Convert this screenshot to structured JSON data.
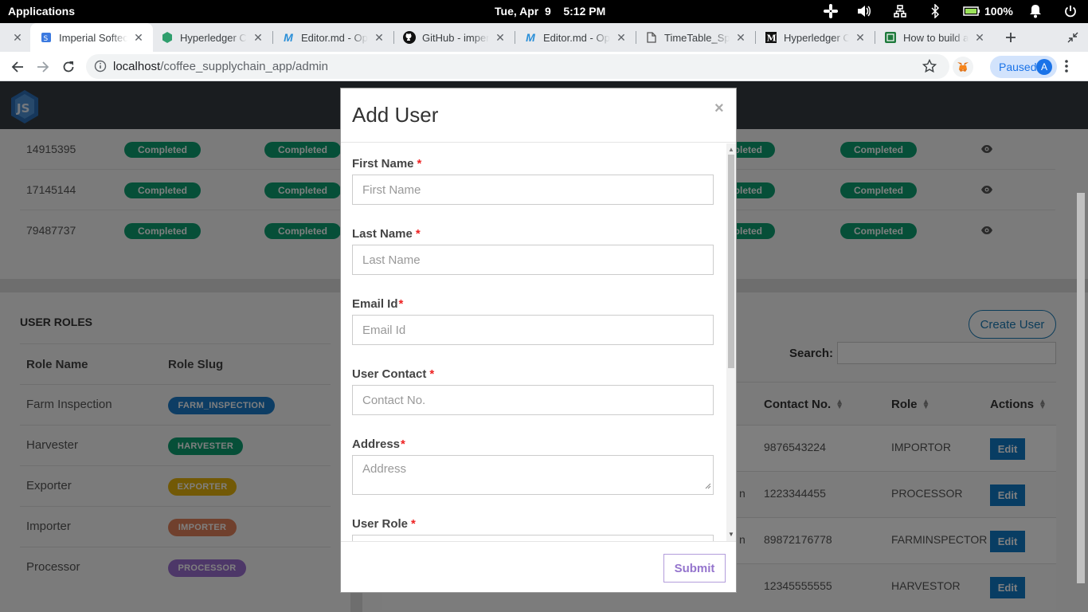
{
  "os": {
    "applications": "Applications",
    "clock": "Tue, Apr  9    5:12 PM",
    "battery": "100%"
  },
  "tabs": [
    {
      "title": "Imperial Softech"
    },
    {
      "title": "Hyperledger Co"
    },
    {
      "title": "Editor.md - Ope"
    },
    {
      "title": "GitHub - imperi"
    },
    {
      "title": "Editor.md - Ope"
    },
    {
      "title": "TimeTable_Spl"
    },
    {
      "title": "Hyperledger Co"
    },
    {
      "title": "How to build a l"
    }
  ],
  "address": {
    "host": "localhost",
    "path": "/coffee_supplychain_app/admin",
    "profile_status": "Paused",
    "avatar_letter": "A"
  },
  "orders": {
    "rows": [
      {
        "id": "14915395",
        "statuses": [
          "Completed",
          "Completed",
          "Completed",
          "Completed"
        ]
      },
      {
        "id": "17145144",
        "statuses": [
          "Completed",
          "Completed",
          "Completed",
          "Completed"
        ]
      },
      {
        "id": "79487737",
        "statuses": [
          "Completed",
          "Completed",
          "Completed",
          "Completed"
        ]
      }
    ]
  },
  "roles": {
    "title": "USER ROLES",
    "headers": [
      "Role Name",
      "Role Slug"
    ],
    "rows": [
      {
        "name": "Farm Inspection",
        "slug": "FARM_INSPECTION",
        "color": "#1a7ac8"
      },
      {
        "name": "Harvester",
        "slug": "HARVESTER",
        "color": "#0d9e70"
      },
      {
        "name": "Exporter",
        "slug": "EXPORTER",
        "color": "#e4b20c"
      },
      {
        "name": "Importer",
        "slug": "IMPORTER",
        "color": "#e0805a"
      },
      {
        "name": "Processor",
        "slug": "PROCESSOR",
        "color": "#9b6ed0"
      }
    ]
  },
  "users": {
    "create_label": "Create User",
    "search_label": "Search:",
    "headers": [
      "Contact No.",
      "Role",
      "Actions"
    ],
    "rows": [
      {
        "name_tail": "",
        "contact": "9876543224",
        "role": "IMPORTOR",
        "action": "Edit"
      },
      {
        "name_tail": "n",
        "contact": "1223344455",
        "role": "PROCESSOR",
        "action": "Edit"
      },
      {
        "name_tail": "n",
        "contact": "89872176778",
        "role": "FARMINSPECTOR",
        "action": "Edit"
      },
      {
        "name_tail": "",
        "contact": "12345555555",
        "role": "HARVESTOR",
        "action": "Edit"
      }
    ]
  },
  "modal": {
    "title": "Add User",
    "close": "×",
    "fields": {
      "first_name": {
        "label": "First Name",
        "placeholder": "First Name"
      },
      "last_name": {
        "label": "Last Name",
        "placeholder": "Last Name"
      },
      "email": {
        "label": "Email Id",
        "placeholder": "Email Id"
      },
      "contact": {
        "label": "User Contact",
        "placeholder": "Contact No."
      },
      "address": {
        "label": "Address",
        "placeholder": "Address"
      },
      "role": {
        "label": "User Role"
      }
    },
    "required_mark": "*",
    "submit_label": "Submit"
  }
}
